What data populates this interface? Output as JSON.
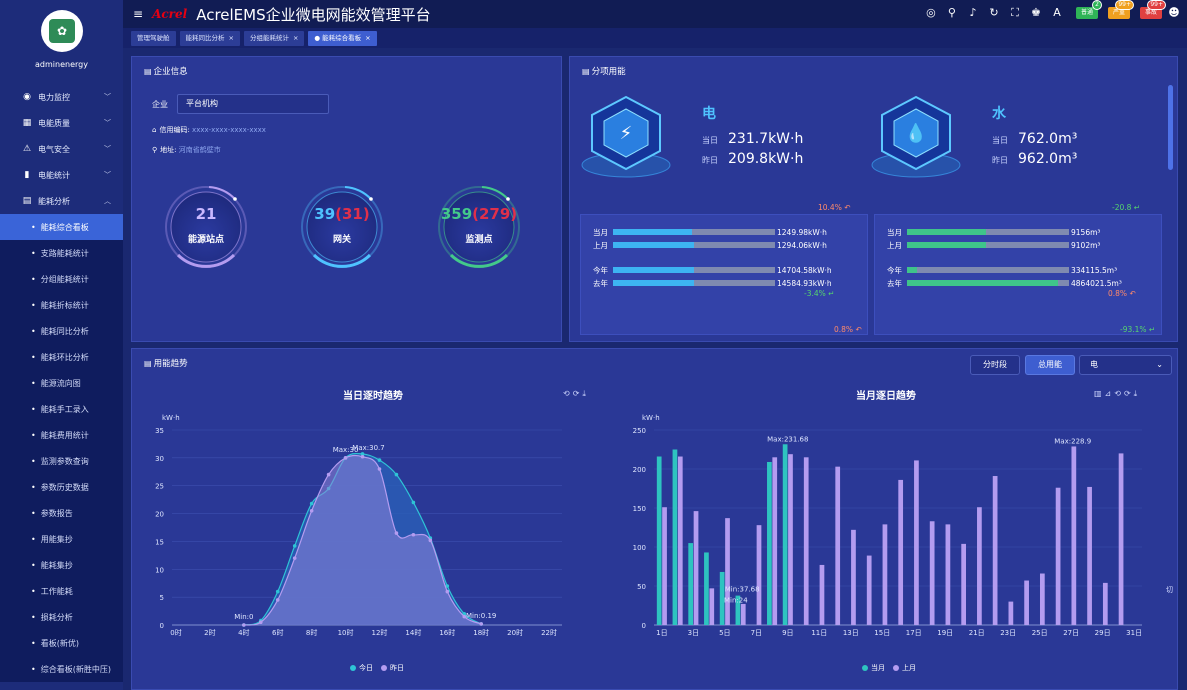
{
  "app": {
    "title": "AcrelEMS企业微电网能效管理平台",
    "logo": "Acrel",
    "username": "adminenergy",
    "avatar_text": "✿"
  },
  "header": {
    "badges": [
      {
        "label": "普通",
        "count": "2",
        "color": "#2fb457"
      },
      {
        "label": "严重",
        "count": "99+",
        "color": "#f0a020"
      },
      {
        "label": "事故",
        "count": "99+",
        "color": "#e04040"
      }
    ]
  },
  "tabs": [
    {
      "label": "管理驾驶舱",
      "active": false,
      "closable": false
    },
    {
      "label": "能耗同比分析",
      "active": false,
      "closable": true
    },
    {
      "label": "分组能耗统计",
      "active": false,
      "closable": true
    },
    {
      "label": "● 能耗综合看板",
      "active": true,
      "closable": true
    }
  ],
  "menu": {
    "top": [
      {
        "label": "电力监控",
        "icon": "◉"
      },
      {
        "label": "电能质量",
        "icon": "▦"
      },
      {
        "label": "电气安全",
        "icon": "⚠"
      },
      {
        "label": "电能统计",
        "icon": "▮"
      },
      {
        "label": "能耗分析",
        "icon": "▤"
      }
    ],
    "sub": [
      {
        "label": "能耗综合看板",
        "active": true
      },
      {
        "label": "支路能耗统计"
      },
      {
        "label": "分组能耗统计"
      },
      {
        "label": "能耗折标统计"
      },
      {
        "label": "能耗同比分析"
      },
      {
        "label": "能耗环比分析"
      },
      {
        "label": "能源流向图"
      },
      {
        "label": "能耗手工录入"
      },
      {
        "label": "能耗费用统计"
      },
      {
        "label": "监测参数查询"
      },
      {
        "label": "参数历史数据"
      },
      {
        "label": "参数报告"
      },
      {
        "label": "用能集抄"
      },
      {
        "label": "能耗集抄"
      },
      {
        "label": "工作能耗"
      },
      {
        "label": "损耗分析"
      },
      {
        "label": "看板(新优)"
      },
      {
        "label": "综合看板(新胜中压)"
      }
    ]
  },
  "enterprise": {
    "title": "企业信息",
    "company_label": "企业",
    "company_value": "平台机构",
    "credit_label": "信用编码:",
    "credit_value": "xxxx-xxxx-xxxx-xxxx",
    "address_label": "地址:",
    "address_value": "河南省鹤壁市",
    "rings": [
      {
        "num": "21",
        "extra": "",
        "label": "能源站点",
        "color": "#b49cf0",
        "numcolor": "#c9b8ff"
      },
      {
        "num": "39",
        "extra": "(31)",
        "label": "网关",
        "color": "#4fc3ff",
        "numcolor": "#4fc3ff"
      },
      {
        "num": "359",
        "extra": "(279)",
        "label": "监测点",
        "color": "#43c98a",
        "numcolor": "#43c98a"
      }
    ]
  },
  "energy": {
    "title": "分项用能",
    "items": [
      {
        "name": "电",
        "today_label": "当日",
        "today": "231.7kW·h",
        "yest_label": "昨日",
        "yest": "209.8kW·h"
      },
      {
        "name": "水",
        "today_label": "当日",
        "today": "762.0m³",
        "yest_label": "昨日",
        "yest": "962.0m³"
      }
    ],
    "cards": [
      {
        "top_pct": "10.4%",
        "top_dir": "up",
        "mid_pct": "-3.4%",
        "mid_dir": "dn",
        "bot_pct": "0.8%",
        "bot_dir": "up",
        "color": "#3db4f2",
        "rows": [
          {
            "label": "当月",
            "value": "1249.98kW·h",
            "ratio": 0.49
          },
          {
            "label": "上月",
            "value": "1294.06kW·h",
            "ratio": 0.5
          },
          {
            "label": "今年",
            "value": "14704.58kW·h",
            "ratio": 0.5
          },
          {
            "label": "去年",
            "value": "14584.93kW·h",
            "ratio": 0.5
          }
        ]
      },
      {
        "top_pct": "-20.8",
        "top_dir": "dn",
        "mid_pct": "0.8%",
        "mid_dir": "up",
        "bot_pct": "-93.1%",
        "bot_dir": "dn",
        "color": "#3fc48a",
        "rows": [
          {
            "label": "当月",
            "value": "9156m³",
            "ratio": 0.49
          },
          {
            "label": "上月",
            "value": "9102m³",
            "ratio": 0.49
          },
          {
            "label": "今年",
            "value": "334115.5m³",
            "ratio": 0.06
          },
          {
            "label": "去年",
            "value": "4864021.5m³",
            "ratio": 0.93
          }
        ]
      }
    ]
  },
  "trend": {
    "title": "用能趋势",
    "btn_period": "分时段",
    "btn_total": "总用能",
    "select": "电",
    "toggle_text": "切",
    "legend_today": "今日",
    "legend_yest": "昨日",
    "legend_month": "当月",
    "legend_lastmonth": "上月"
  },
  "chart_data": [
    {
      "type": "area",
      "title": "当日逐时趋势",
      "ylabel": "kW·h",
      "ylim": [
        0,
        35
      ],
      "yticks": [
        0,
        5,
        10,
        15,
        20,
        25,
        30,
        35
      ],
      "x": [
        "0时",
        "2时",
        "4时",
        "6时",
        "8时",
        "10时",
        "12时",
        "14时",
        "16时",
        "18时",
        "20时",
        "22时"
      ],
      "series": [
        {
          "name": "今日",
          "color": "#2ec4d6",
          "values": [
            [
              4,
              0
            ],
            [
              5,
              0.8
            ],
            [
              6,
              6
            ],
            [
              7,
              14.2
            ],
            [
              8,
              21.8
            ],
            [
              9,
              24.5
            ],
            [
              10,
              30
            ],
            [
              11,
              30.7
            ],
            [
              12,
              29.6
            ],
            [
              13,
              27
            ],
            [
              14,
              22
            ],
            [
              15,
              15.6
            ],
            [
              16,
              7
            ],
            [
              17,
              2
            ],
            [
              18,
              0.19
            ]
          ]
        },
        {
          "name": "昨日",
          "color": "#b49cf0",
          "values": [
            [
              4,
              0
            ],
            [
              5,
              0.5
            ],
            [
              6,
              4.5
            ],
            [
              7,
              12
            ],
            [
              8,
              20.5
            ],
            [
              9,
              27
            ],
            [
              10,
              30
            ],
            [
              11,
              30.2
            ],
            [
              12,
              28
            ],
            [
              13,
              16.5
            ],
            [
              14,
              16.2
            ],
            [
              15,
              15.2
            ],
            [
              16,
              6
            ],
            [
              17,
              1.5
            ],
            [
              18,
              0.19
            ]
          ]
        }
      ],
      "annotations": [
        "Max:30",
        "Max:30.7",
        "Min:0",
        "Min:0.19"
      ]
    },
    {
      "type": "bar",
      "title": "当月逐日趋势",
      "ylabel": "kW·h",
      "ylim": [
        0,
        250
      ],
      "yticks": [
        0,
        50,
        100,
        150,
        200,
        250
      ],
      "categories": [
        "1日",
        "2日",
        "3日",
        "4日",
        "5日",
        "6日",
        "7日",
        "8日",
        "9日",
        "10日",
        "11日",
        "12日",
        "13日",
        "14日",
        "15日",
        "16日",
        "17日",
        "18日",
        "19日",
        "20日",
        "21日",
        "22日",
        "23日",
        "24日",
        "25日",
        "26日",
        "27日",
        "28日",
        "29日",
        "30日",
        "31日"
      ],
      "xtick_labels": [
        "1日",
        "3日",
        "5日",
        "7日",
        "9日",
        "11日",
        "13日",
        "15日",
        "17日",
        "19日",
        "21日",
        "23日",
        "25日",
        "27日",
        "29日",
        "31日"
      ],
      "series": [
        {
          "name": "当月",
          "color": "#2ec4c0",
          "values": [
            216,
            225,
            105,
            93,
            68,
            37.68,
            null,
            209,
            231.68,
            null,
            null,
            null,
            null,
            null,
            null,
            null,
            null,
            null,
            null,
            null,
            null,
            null,
            null,
            null,
            null,
            null,
            null,
            null,
            null,
            null,
            null
          ]
        },
        {
          "name": "上月",
          "color": "#b49cf0",
          "values": [
            151,
            216,
            146,
            47,
            137,
            27,
            128,
            215,
            219,
            215,
            77,
            203,
            122,
            89,
            129,
            186,
            211,
            133,
            129,
            104,
            151,
            191,
            30,
            57,
            66,
            176,
            228.9,
            177,
            54,
            220,
            null
          ]
        }
      ],
      "annotations": [
        "Max:231.68",
        "Max:228.9",
        "Min:37.68",
        "Min:24"
      ]
    }
  ]
}
